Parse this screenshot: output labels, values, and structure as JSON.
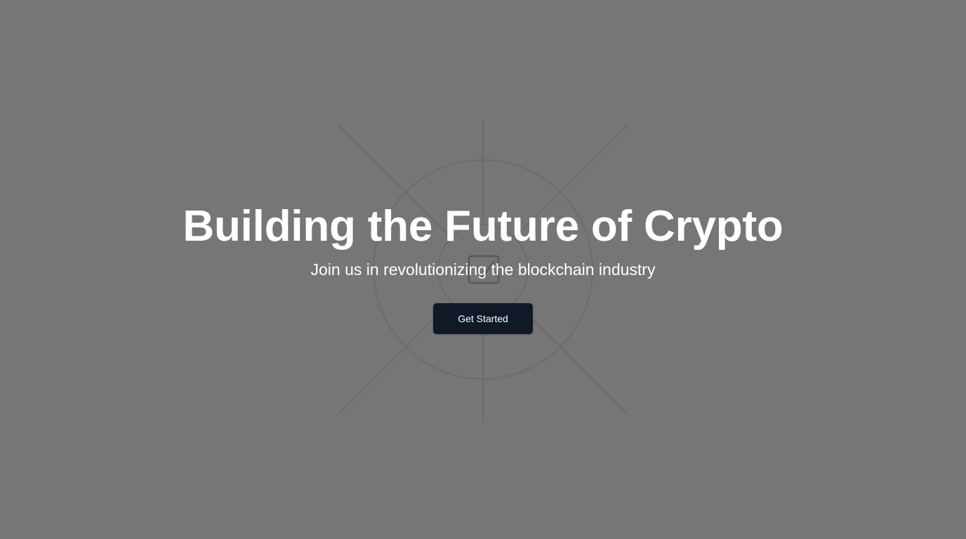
{
  "hero": {
    "headline": "Building the Future of Crypto",
    "subheadline": "Join us in revolutionizing the blockchain industry",
    "cta_label": "Get Started"
  },
  "theme": {
    "overlay_background": "#767676",
    "text_color": "#ffffff",
    "button_background": "#111827",
    "button_text": "#ffffff",
    "graphic_stroke": "#6a6a6a"
  },
  "icons": {
    "background_graphic": "radial-network-graphic",
    "center_icon": "checkbox-icon"
  }
}
